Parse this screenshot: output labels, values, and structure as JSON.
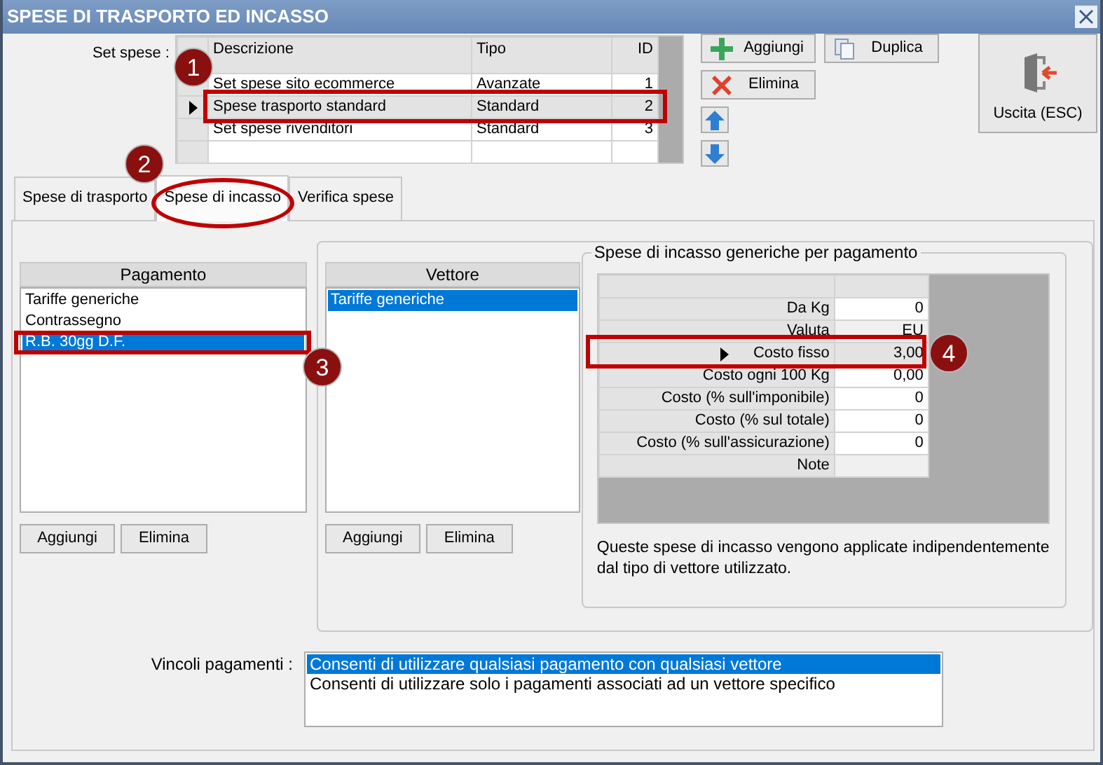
{
  "window": {
    "title": "SPESE DI TRASPORTO ED INCASSO"
  },
  "set_spese": {
    "label": "Set spese :",
    "columns": [
      "Descrizione",
      "Tipo",
      "ID"
    ],
    "rows": [
      {
        "descrizione": "Set spese sito ecommerce",
        "tipo": "Avanzate",
        "id": "1",
        "selected": false
      },
      {
        "descrizione": "Spese trasporto standard",
        "tipo": "Standard",
        "id": "2",
        "selected": true
      },
      {
        "descrizione": "Set spese rivenditori",
        "tipo": "Standard",
        "id": "3",
        "selected": false
      }
    ]
  },
  "toolbar": [
    {
      "label": "Aggiungi",
      "kind": "add"
    },
    {
      "label": "Duplica",
      "kind": "duplicate"
    },
    {
      "label": "Elimina",
      "kind": "delete"
    },
    {
      "kind": "up"
    },
    {
      "kind": "down"
    }
  ],
  "exit_button": {
    "label": "Uscita (ESC)"
  },
  "tabs": [
    {
      "label": "Spese di trasporto",
      "selected": false
    },
    {
      "label": "Spese di incasso",
      "selected": true
    },
    {
      "label": "Verifica spese",
      "selected": false
    }
  ],
  "pagamento": {
    "header": "Pagamento",
    "items": [
      {
        "label": "Tariffe generiche",
        "selected": false
      },
      {
        "label": "Contrassegno",
        "selected": false
      },
      {
        "label": "R.B. 30gg D.F.",
        "selected": true
      }
    ],
    "buttons": [
      "Aggiungi",
      "Elimina"
    ]
  },
  "vettore": {
    "header": "Vettore",
    "items": [
      {
        "label": "Tariffe generiche",
        "selected": true
      }
    ],
    "buttons": [
      "Aggiungi",
      "Elimina"
    ]
  },
  "incasso": {
    "title": "Spese di incasso generiche per pagamento",
    "rows": [
      {
        "label": "Da Kg",
        "value": "0",
        "readonly": false,
        "selected": false
      },
      {
        "label": "Valuta",
        "value": "EU",
        "readonly": true,
        "selected": false
      },
      {
        "label": "Costo fisso",
        "value": "3,00",
        "readonly": false,
        "selected": true
      },
      {
        "label": "Costo ogni 100 Kg",
        "value": "0,00",
        "readonly": false,
        "selected": false
      },
      {
        "label": "Costo (% sull'imponibile)",
        "value": "0",
        "readonly": false,
        "selected": false
      },
      {
        "label": "Costo (% sul totale)",
        "value": "0",
        "readonly": false,
        "selected": false
      },
      {
        "label": "Costo (% sull'assicurazione)",
        "value": "0",
        "readonly": false,
        "selected": false
      },
      {
        "label": "Note",
        "value": "",
        "readonly": true,
        "selected": false
      }
    ],
    "note": "Queste spese di incasso vengono applicate indipendentemente dal tipo di vettore utilizzato."
  },
  "vincoli": {
    "label": "Vincoli pagamenti :",
    "options": [
      {
        "label": "Consenti di utilizzare qualsiasi pagamento con qualsiasi vettore",
        "selected": true
      },
      {
        "label": "Consenti di utilizzare solo i pagamenti associati ad un vettore specifico",
        "selected": false
      }
    ]
  },
  "annotations": [
    {
      "number": "1",
      "kind": "rect"
    },
    {
      "number": "2",
      "kind": "ellipse"
    },
    {
      "number": "3",
      "kind": "rect"
    },
    {
      "number": "4",
      "kind": "rect"
    }
  ]
}
